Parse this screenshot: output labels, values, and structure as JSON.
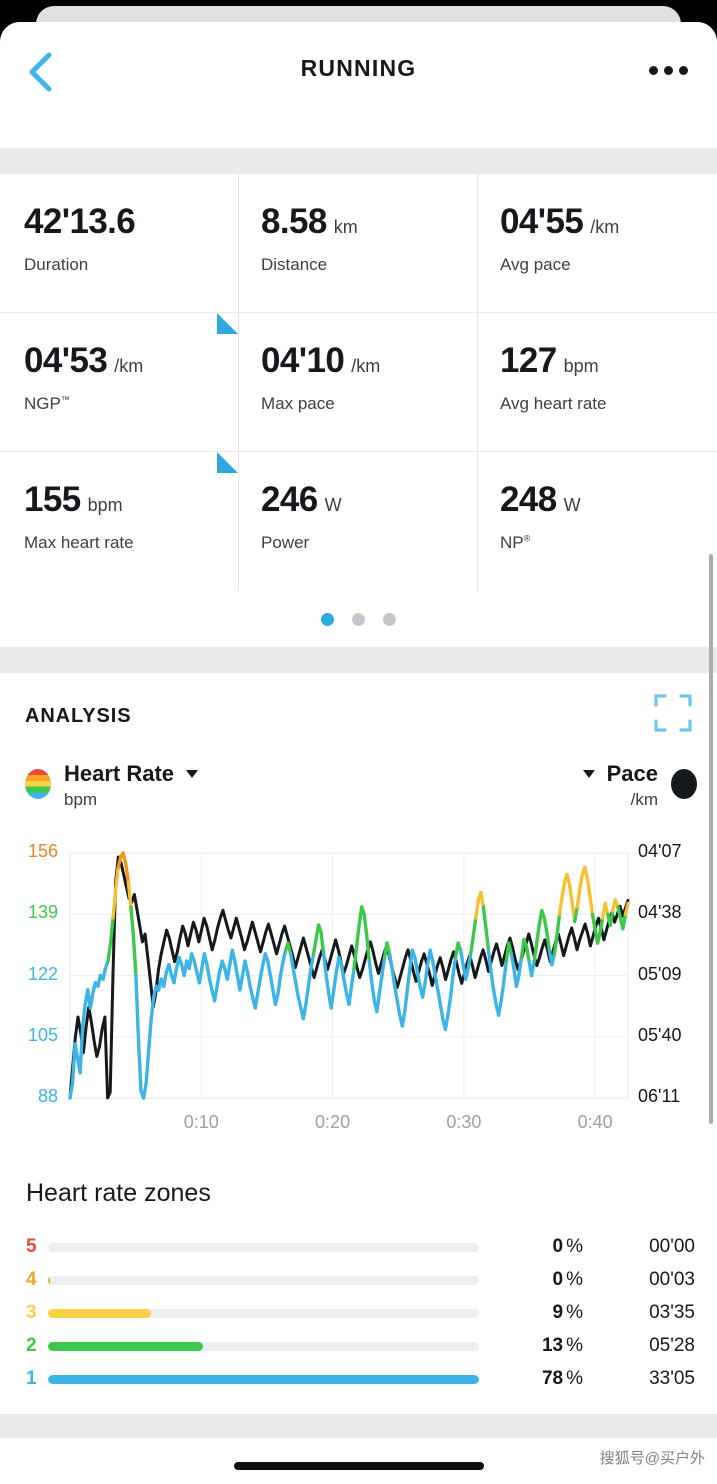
{
  "header": {
    "title": "RUNNING",
    "back_icon": "chevron-left-icon",
    "more_icon": "more-horizontal-icon"
  },
  "stats": {
    "cells": [
      {
        "value": "42'13.6",
        "unit": "",
        "label": "Duration",
        "label_sup": "",
        "flag": false
      },
      {
        "value": "8.58",
        "unit": "km",
        "label": "Distance",
        "label_sup": "",
        "flag": false
      },
      {
        "value": "04'55",
        "unit": "/km",
        "label": "Avg pace",
        "label_sup": "",
        "flag": false
      },
      {
        "value": "04'53",
        "unit": "/km",
        "label": "NGP",
        "label_sup": "™",
        "flag": true
      },
      {
        "value": "04'10",
        "unit": "/km",
        "label": "Max pace",
        "label_sup": "",
        "flag": false
      },
      {
        "value": "127",
        "unit": "bpm",
        "label": "Avg heart rate",
        "label_sup": "",
        "flag": false
      },
      {
        "value": "155",
        "unit": "bpm",
        "label": "Max heart rate",
        "label_sup": "",
        "flag": true
      },
      {
        "value": "246",
        "unit": "W",
        "label": "Power",
        "label_sup": "",
        "flag": false
      },
      {
        "value": "248",
        "unit": "W",
        "label": "NP",
        "label_sup": "®",
        "flag": false
      }
    ],
    "pager": {
      "count": 3,
      "active": 0
    }
  },
  "analysis": {
    "title": "ANALYSIS",
    "expand_icon": "fullscreen-expand-icon",
    "left_series": {
      "name": "Heart Rate",
      "unit": "bpm",
      "swatch_icon": "hr-zone-gradient-icon",
      "caret_icon": "chevron-down-icon"
    },
    "right_series": {
      "name": "Pace",
      "unit": "/km",
      "swatch_icon": "pace-dot-icon",
      "caret_icon": "chevron-down-icon"
    }
  },
  "chart_data": {
    "type": "line",
    "title": "",
    "xlabel": "",
    "ylabel": "bpm",
    "grid": true,
    "legend_position": "top",
    "x_ticks": [
      "0:10",
      "0:20",
      "0:30",
      "0:40"
    ],
    "x_tick_values": [
      10,
      20,
      30,
      40
    ],
    "xlim": [
      0,
      42.5
    ],
    "y_left_ticks": [
      "88",
      "105",
      "122",
      "139",
      "156"
    ],
    "y_left_tick_values": [
      88,
      105,
      122,
      139,
      156
    ],
    "y_left_tick_colors": [
      "#3cb4e5",
      "#3cb4e5",
      "#3cb4e5",
      "#3cc84a",
      "#e8842a"
    ],
    "ylim_left": [
      88,
      156
    ],
    "y_right_ticks": [
      "06'11",
      "05'40",
      "05'09",
      "04'38",
      "04'07"
    ],
    "y_right_tick_values": [
      371,
      340,
      309,
      278,
      247
    ],
    "ylim_right": [
      371,
      247
    ],
    "series": [
      {
        "name": "Heart Rate",
        "unit": "bpm",
        "zone_colored": true,
        "zone_breaks": [
          {
            "max": 129,
            "color": "#3cb4e5"
          },
          {
            "max": 141,
            "color": "#3cc84a"
          },
          {
            "max": 152,
            "color": "#f5c132"
          },
          {
            "max": 160,
            "color": "#f0941f"
          }
        ],
        "values": [
          88,
          92,
          103,
          99,
          95,
          108,
          114,
          118,
          113,
          117,
          120,
          119,
          122,
          121,
          124,
          126,
          131,
          138,
          146,
          152,
          155,
          156,
          153,
          148,
          141,
          133,
          122,
          104,
          90,
          88,
          92,
          101,
          110,
          116,
          119,
          118,
          121,
          119,
          123,
          125,
          122,
          120,
          124,
          127,
          125,
          122,
          126,
          124,
          128,
          126,
          123,
          120,
          124,
          128,
          125,
          121,
          118,
          115,
          119,
          123,
          126,
          124,
          121,
          125,
          129,
          126,
          122,
          118,
          122,
          126,
          123,
          119,
          116,
          113,
          117,
          121,
          125,
          128,
          126,
          122,
          118,
          114,
          117,
          122,
          126,
          129,
          131,
          128,
          124,
          120,
          116,
          113,
          110,
          114,
          119,
          124,
          128,
          132,
          136,
          134,
          128,
          122,
          117,
          113,
          118,
          123,
          127,
          125,
          121,
          117,
          114,
          119,
          124,
          130,
          136,
          141,
          139,
          133,
          126,
          120,
          115,
          112,
          117,
          122,
          127,
          131,
          128,
          124,
          119,
          115,
          111,
          108,
          112,
          118,
          124,
          129,
          127,
          123,
          119,
          116,
          120,
          125,
          129,
          126,
          122,
          118,
          114,
          110,
          107,
          111,
          116,
          122,
          127,
          131,
          129,
          125,
          121,
          124,
          128,
          133,
          138,
          143,
          145,
          141,
          135,
          129,
          123,
          118,
          114,
          111,
          115,
          120,
          126,
          131,
          128,
          124,
          119,
          122,
          127,
          132,
          130,
          126,
          122,
          126,
          131,
          136,
          140,
          138,
          134,
          129,
          125,
          128,
          133,
          139,
          144,
          148,
          150,
          147,
          142,
          137,
          141,
          146,
          150,
          152,
          149,
          144,
          139,
          135,
          131,
          134,
          138,
          142,
          139,
          136,
          140,
          143,
          141,
          138,
          135,
          139,
          142
        ]
      },
      {
        "name": "Pace",
        "unit": "/km",
        "color": "#15191d",
        "values": [
          371,
          355,
          340,
          330,
          338,
          348,
          335,
          325,
          333,
          342,
          350,
          345,
          336,
          330,
          371,
          368,
          310,
          262,
          249,
          252,
          258,
          264,
          270,
          272,
          268,
          276,
          284,
          292,
          288,
          300,
          312,
          325,
          318,
          306,
          298,
          292,
          286,
          290,
          296,
          302,
          297,
          290,
          284,
          288,
          294,
          288,
          282,
          286,
          292,
          286,
          280,
          284,
          290,
          296,
          291,
          285,
          280,
          276,
          281,
          286,
          290,
          285,
          280,
          285,
          290,
          296,
          292,
          287,
          282,
          287,
          292,
          297,
          292,
          287,
          283,
          288,
          293,
          298,
          293,
          288,
          284,
          289,
          294,
          299,
          305,
          300,
          295,
          290,
          295,
          300,
          305,
          310,
          305,
          300,
          296,
          301,
          306,
          301,
          296,
          291,
          296,
          302,
          308,
          304,
          299,
          294,
          299,
          305,
          310,
          306,
          301,
          296,
          292,
          297,
          303,
          308,
          303,
          298,
          294,
          299,
          305,
          310,
          315,
          310,
          305,
          300,
          296,
          301,
          307,
          312,
          307,
          302,
          298,
          303,
          308,
          314,
          309,
          304,
          300,
          305,
          311,
          306,
          301,
          297,
          302,
          308,
          313,
          308,
          303,
          299,
          304,
          310,
          305,
          300,
          296,
          301,
          307,
          302,
          297,
          293,
          298,
          304,
          299,
          294,
          290,
          295,
          301,
          306,
          302,
          297,
          293,
          288,
          293,
          299,
          304,
          300,
          295,
          291,
          296,
          302,
          297,
          292,
          288,
          293,
          299,
          294,
          289,
          285,
          290,
          296,
          291,
          287,
          283,
          288,
          294,
          289,
          284,
          280,
          285,
          291,
          286,
          281,
          277,
          282,
          278,
          274,
          279,
          275,
          271
        ]
      }
    ]
  },
  "zones": {
    "title": "Heart rate zones",
    "rows": [
      {
        "zone": "5",
        "color": "#e84a3b",
        "percent": "0",
        "percent_symbol": "%",
        "time": "00'00",
        "fill": 0
      },
      {
        "zone": "4",
        "color": "#f5a623",
        "percent": "0",
        "percent_symbol": "%",
        "time": "00'03",
        "fill": 0.5
      },
      {
        "zone": "3",
        "color": "#f8d146",
        "percent": "9",
        "percent_symbol": "%",
        "time": "03'35",
        "fill": 24
      },
      {
        "zone": "2",
        "color": "#3cc84a",
        "percent": "13",
        "percent_symbol": "%",
        "time": "05'28",
        "fill": 36
      },
      {
        "zone": "1",
        "color": "#3cb4e5",
        "percent": "78",
        "percent_symbol": "%",
        "time": "33'05",
        "fill": 100
      }
    ]
  },
  "footer": {
    "watermark": "搜狐号@买户外"
  }
}
